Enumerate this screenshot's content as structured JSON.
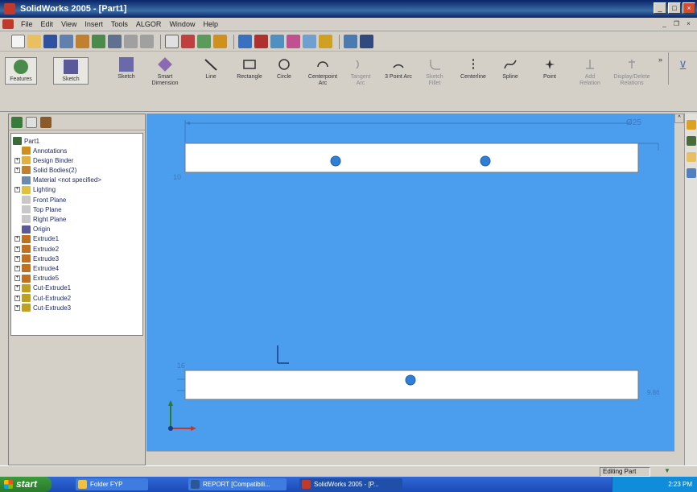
{
  "window": {
    "title": "SolidWorks 2005 - [Part1]"
  },
  "menu": {
    "items": [
      "File",
      "Edit",
      "View",
      "Insert",
      "Tools",
      "ALGOR",
      "Window",
      "Help"
    ]
  },
  "command_manager": {
    "items": [
      {
        "label": "Features",
        "icon": "features-icon",
        "enabled": true
      },
      {
        "label": "Sketch",
        "icon": "sketch-icon",
        "enabled": true
      },
      {
        "label": "Sketch",
        "icon": "sketch-toggle-icon",
        "enabled": true
      },
      {
        "label": "Smart Dimension",
        "icon": "smart-dimension-icon",
        "enabled": true
      },
      {
        "label": "Line",
        "icon": "line-icon",
        "enabled": true
      },
      {
        "label": "Rectangle",
        "icon": "rectangle-icon",
        "enabled": true
      },
      {
        "label": "Circle",
        "icon": "circle-icon",
        "enabled": true
      },
      {
        "label": "Centerpoint Arc",
        "icon": "centerpoint-arc-icon",
        "enabled": true
      },
      {
        "label": "Tangent Arc",
        "icon": "tangent-arc-icon",
        "enabled": false
      },
      {
        "label": "3 Point Arc",
        "icon": "three-point-arc-icon",
        "enabled": true
      },
      {
        "label": "Sketch Fillet",
        "icon": "sketch-fillet-icon",
        "enabled": false
      },
      {
        "label": "Centerline",
        "icon": "centerline-icon",
        "enabled": true
      },
      {
        "label": "Spline",
        "icon": "spline-icon",
        "enabled": true
      },
      {
        "label": "Point",
        "icon": "point-icon",
        "enabled": true
      },
      {
        "label": "Add Relation",
        "icon": "add-relation-icon",
        "enabled": false
      },
      {
        "label": "Display/Delete Relations",
        "icon": "display-relations-icon",
        "enabled": false
      }
    ]
  },
  "feature_tree": {
    "root": "Part1",
    "items": [
      {
        "label": "Annotations",
        "icon": "annotations-icon",
        "expander": false
      },
      {
        "label": "Design Binder",
        "icon": "design-binder-icon",
        "expander": true
      },
      {
        "label": "Solid Bodies(2)",
        "icon": "solid-bodies-icon",
        "expander": true
      },
      {
        "label": "Material <not specified>",
        "icon": "material-icon",
        "expander": false
      },
      {
        "label": "Lighting",
        "icon": "lighting-icon",
        "expander": true
      },
      {
        "label": "Front Plane",
        "icon": "plane-icon",
        "expander": false
      },
      {
        "label": "Top Plane",
        "icon": "plane-icon",
        "expander": false
      },
      {
        "label": "Right Plane",
        "icon": "plane-icon",
        "expander": false
      },
      {
        "label": "Origin",
        "icon": "origin-icon",
        "expander": false
      },
      {
        "label": "Extrude1",
        "icon": "extrude-icon",
        "expander": true
      },
      {
        "label": "Extrude2",
        "icon": "extrude-icon",
        "expander": true
      },
      {
        "label": "Extrude3",
        "icon": "extrude-icon",
        "expander": true
      },
      {
        "label": "Extrude4",
        "icon": "extrude-icon",
        "expander": true
      },
      {
        "label": "Extrude5",
        "icon": "extrude-icon",
        "expander": true
      },
      {
        "label": "Cut-Extrude1",
        "icon": "cut-extrude-icon",
        "expander": true
      },
      {
        "label": "Cut-Extrude2",
        "icon": "cut-extrude-icon",
        "expander": true
      },
      {
        "label": "Cut-Extrude3",
        "icon": "cut-extrude-icon",
        "expander": true
      }
    ]
  },
  "graphics": {
    "background": "#4a9eed",
    "dimension_top": "Ø25",
    "label_top_left": "10",
    "label_bottom_left": "16",
    "label_bottom_right": "9.86"
  },
  "status": {
    "editing": "Editing Part"
  },
  "taskbar": {
    "start": "start",
    "buttons": [
      {
        "label": "Folder FYP",
        "icon": "folder-icon"
      },
      {
        "label": "REPORT [Compatibili...",
        "icon": "word-icon"
      },
      {
        "label": "SolidWorks 2005 - [P...",
        "icon": "solidworks-icon"
      }
    ],
    "clock": "2:23 PM"
  }
}
